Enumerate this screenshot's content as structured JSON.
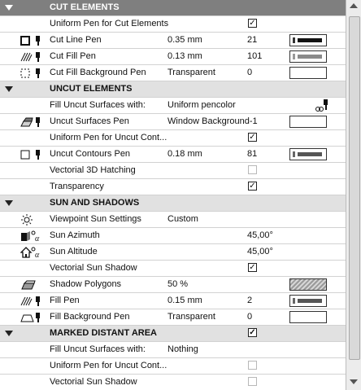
{
  "colors": {
    "section_dark": "#7f7f7f",
    "section_light": "#e1e1e1",
    "border": "#d2d2d2"
  },
  "checkmark": "✓",
  "sections": {
    "cut": {
      "title": "CUT ELEMENTS"
    },
    "uncut": {
      "title": "UNCUT ELEMENTS"
    },
    "sun": {
      "title": "SUN AND SHADOWS"
    },
    "marked": {
      "title": "MARKED DISTANT AREA",
      "checked": true
    }
  },
  "cut": {
    "uniform_pen": {
      "label": "Uniform Pen for Cut Elements",
      "checked": true
    },
    "line_pen": {
      "label": "Cut Line Pen",
      "value": "0.35 mm",
      "num": "21",
      "icon": "line-pen-icon"
    },
    "fill_pen": {
      "label": "Cut Fill Pen",
      "value": "0.13 mm",
      "num": "101",
      "icon": "fill-pen-icon"
    },
    "bg_pen": {
      "label": "Cut Fill Background Pen",
      "value": "Transparent",
      "num": "0",
      "icon": "background-pen-icon"
    }
  },
  "uncut": {
    "fill_surfaces": {
      "label": "Fill Uncut Surfaces with:",
      "value": "Uniform pencolor",
      "icon": "pencolor-icon"
    },
    "surfaces_pen": {
      "label": "Uncut Surfaces Pen",
      "value": "Window Background-1",
      "icon": "surface-pen-icon"
    },
    "uniform_contours": {
      "label": "Uniform Pen for Uncut Cont...",
      "checked": true
    },
    "contours_pen": {
      "label": "Uncut Contours Pen",
      "value": "0.18 mm",
      "num": "81",
      "icon": "contour-pen-icon"
    },
    "hatching": {
      "label": "Vectorial 3D Hatching",
      "checked": false
    },
    "transparency": {
      "label": "Transparency",
      "checked": true
    }
  },
  "sun": {
    "viewpoint": {
      "label": "Viewpoint Sun Settings",
      "value": "Custom",
      "icon": "sun-icon"
    },
    "azimuth": {
      "label": "Sun Azimuth",
      "num": "45,00°",
      "icon": "sun-azimuth-icon"
    },
    "altitude": {
      "label": "Sun Altitude",
      "num": "45,00°",
      "icon": "sun-altitude-icon"
    },
    "vectorial_shadow": {
      "label": "Vectorial Sun Shadow",
      "checked": true
    },
    "shadow_polygons": {
      "label": "Shadow Polygons",
      "value": "50 %",
      "icon": "shadow-polygon-icon"
    },
    "fill_pen": {
      "label": "Fill Pen",
      "value": "0.15 mm",
      "num": "2",
      "icon": "fill-pen-icon"
    },
    "fill_bg_pen": {
      "label": "Fill Background Pen",
      "value": "Transparent",
      "num": "0",
      "icon": "background-pen-icon"
    }
  },
  "marked": {
    "fill_surfaces": {
      "label": "Fill Uncut Surfaces with:",
      "value": "Nothing"
    },
    "uniform_contours": {
      "label": "Uniform Pen for Uncut Cont...",
      "checked": false
    },
    "vectorial_shadow": {
      "label": "Vectorial Sun Shadow",
      "checked": false
    }
  }
}
